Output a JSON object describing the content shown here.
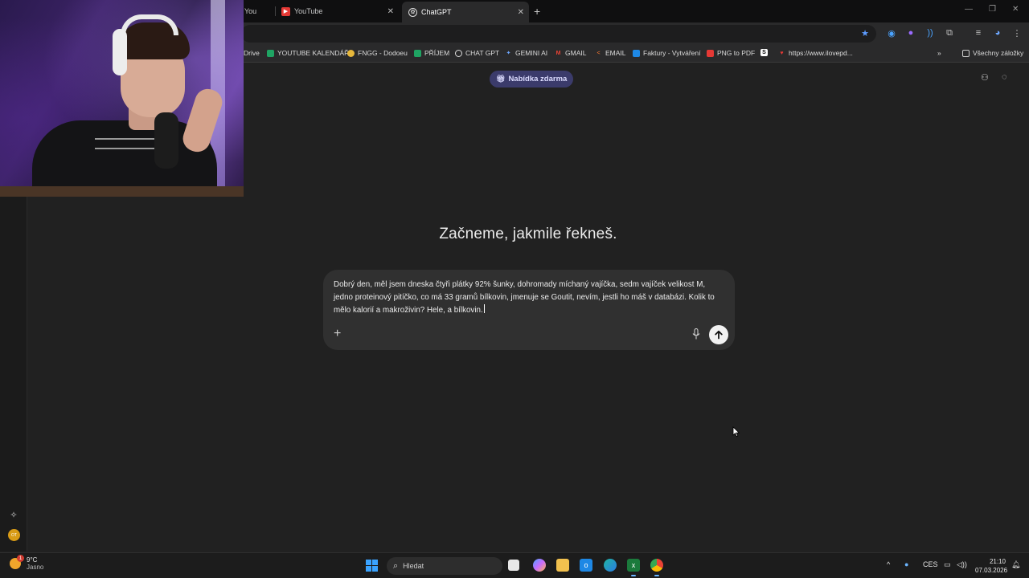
{
  "browser": {
    "tabs": [
      {
        "label": "You",
        "icon": "youtube-icon"
      },
      {
        "label": "YouTube",
        "icon": "youtube-icon"
      },
      {
        "label": "ChatGPT",
        "icon": "chatgpt-icon",
        "active": true
      }
    ],
    "new_tab_label": "+",
    "bookmarks": [
      {
        "label": "Drive"
      },
      {
        "label": "YOUTUBE KALENDÁŘ"
      },
      {
        "label": "FNGG - Dodoeu"
      },
      {
        "label": "PŘÍJEM"
      },
      {
        "label": "CHAT GPT"
      },
      {
        "label": "GEMINI AI"
      },
      {
        "label": "GMAIL"
      },
      {
        "label": "EMAIL"
      },
      {
        "label": "Faktury - Vytváření"
      },
      {
        "label": "PNG to PDF"
      },
      {
        "label": ""
      },
      {
        "label": "https://www.ilovepd..."
      }
    ],
    "all_bookmarks_label": "Všechny záložky"
  },
  "chat": {
    "offer_label": "Nabídka zdarma",
    "headline": "Začneme, jakmile řekneš.",
    "composer_text": "Dobrý den, měl jsem dneska čtyři plátky 92% šunky, dohromady míchaný vajíčka, sedm vajíček velikost M, jedno proteinový pitíčko, co má 33 gramů bílkovin, jmenuje se Goutit, nevím, jestli ho máš v databázi. Kolik to mělo kalorií a makroživin? Hele, a bílkovin.",
    "plus_label": "+"
  },
  "sidebar": {
    "avatar_initials": "OT"
  },
  "taskbar": {
    "weather_badge": "1",
    "temperature": "9°C",
    "weather_desc": "Jasno",
    "search_placeholder": "Hledat",
    "language": "CES",
    "time": "21:10",
    "date": "07.03.2026"
  },
  "colors": {
    "page_bg": "#212121",
    "composer_bg": "#303030",
    "offer_pill_bg": "#3b3b6b",
    "win_accent": "#3aa3ff"
  }
}
